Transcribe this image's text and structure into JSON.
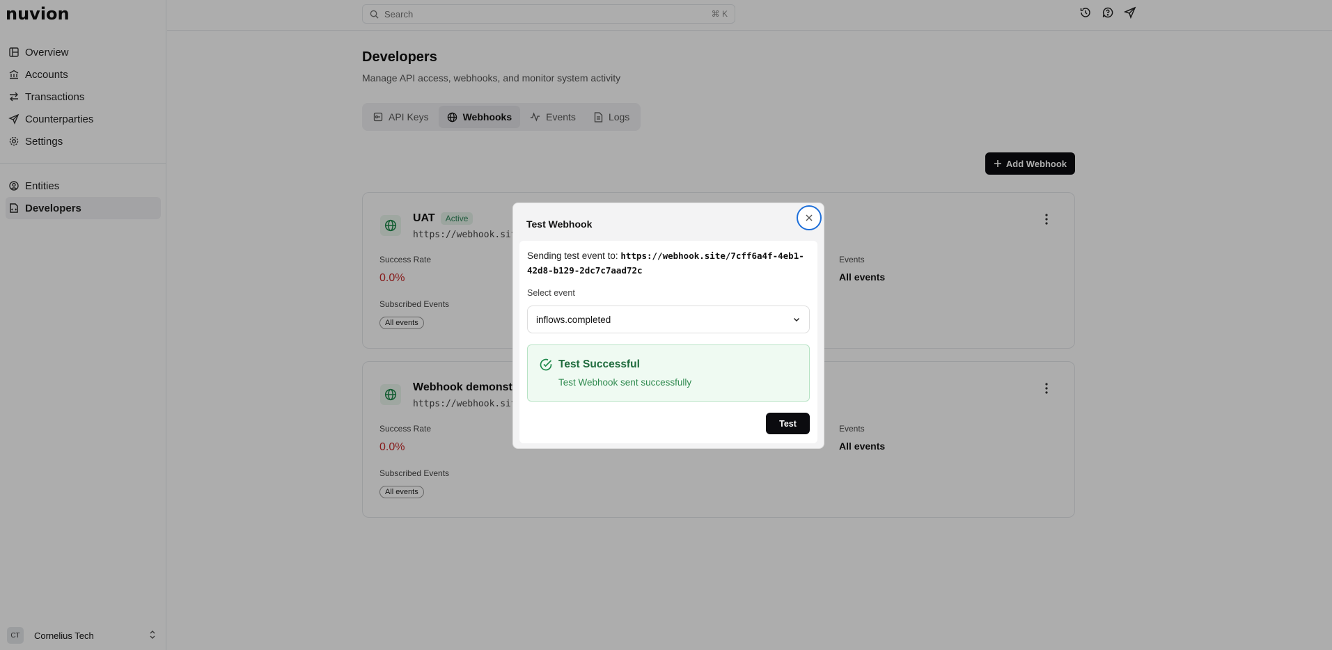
{
  "brand": {
    "logo": "nuvion"
  },
  "sidebar": {
    "primary": [
      {
        "label": "Overview",
        "icon": "layout-icon"
      },
      {
        "label": "Accounts",
        "icon": "bank-icon"
      },
      {
        "label": "Transactions",
        "icon": "arrows-icon"
      },
      {
        "label": "Counterparties",
        "icon": "send-icon"
      },
      {
        "label": "Settings",
        "icon": "gear-icon"
      }
    ],
    "secondary": [
      {
        "label": "Entities",
        "icon": "user-circle-icon"
      },
      {
        "label": "Developers",
        "icon": "code-file-icon",
        "active": true
      }
    ],
    "org": {
      "initials": "CT",
      "name": "Cornelius Tech"
    }
  },
  "topbar": {
    "search_placeholder": "Search",
    "search_shortcut": "⌘ K"
  },
  "page": {
    "title": "Developers",
    "subtitle": "Manage API access, webhooks, and monitor system activity",
    "tabs": [
      {
        "label": "API Keys"
      },
      {
        "label": "Webhooks",
        "active": true
      },
      {
        "label": "Events"
      },
      {
        "label": "Logs"
      }
    ],
    "add_button": "Add Webhook"
  },
  "webhooks": [
    {
      "name": "UAT",
      "status": "Active",
      "url": "https://webhook.sit",
      "success_rate_label": "Success Rate",
      "success_rate": "0.0%",
      "events_label": "Events",
      "events_value": "All events",
      "subscribed_label": "Subscribed Events",
      "subscribed_chip": "All events"
    },
    {
      "name": "Webhook demonstr",
      "status": "",
      "url": "https://webhook.sit",
      "success_rate_label": "Success Rate",
      "success_rate": "0.0%",
      "events_label": "Events",
      "events_value": "All events",
      "subscribed_label": "Subscribed Events",
      "subscribed_chip": "All events"
    }
  ],
  "modal": {
    "title": "Test Webhook",
    "sending_prefix": "Sending test event to:",
    "target_url": "https://webhook.site/7cff6a4f-4eb1-42d8-b129-2dc7c7aad72c",
    "select_label": "Select event",
    "selected_event": "inflows.completed",
    "success_title": "Test Successful",
    "success_message": "Test Webhook sent successfully",
    "test_button": "Test"
  },
  "colors": {
    "accent_dark": "#0b0b0f",
    "success_green": "#1f6b3d",
    "rate_red": "#c62828",
    "focus_blue": "#1e6fd9"
  }
}
